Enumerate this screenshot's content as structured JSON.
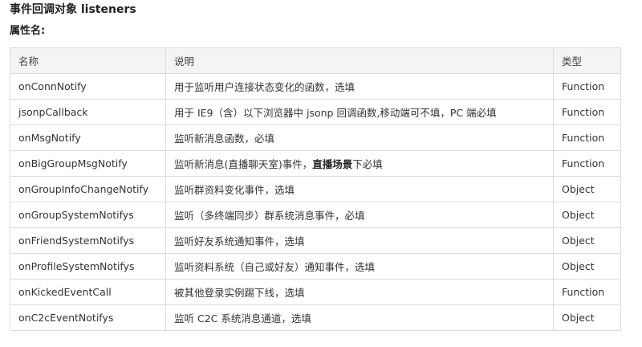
{
  "title": "事件回调对象 listeners",
  "subtitle": "属性名:",
  "table": {
    "headers": [
      "名称",
      "说明",
      "类型"
    ],
    "rows": [
      {
        "name": "onConnNotify",
        "desc": "用于监听用户连接状态变化的函数，选填",
        "type": "Function"
      },
      {
        "name": "jsonpCallback",
        "desc": "用于 IE9（含）以下浏览器中 jsonp 回调函数,移动端可不填，PC 端必填",
        "type": "Function"
      },
      {
        "name": "onMsgNotify",
        "desc": "监听新消息函数，必填",
        "type": "Function"
      },
      {
        "name": "onBigGroupMsgNotify",
        "desc_pre": "监听新消息(直播聊天室)事件，",
        "desc_bold": "直播场景",
        "desc_post": "下必填",
        "type": "Function"
      },
      {
        "name": "onGroupInfoChangeNotify",
        "desc": "监听群资料变化事件，选填",
        "type": "Object"
      },
      {
        "name": "onGroupSystemNotifys",
        "desc": "监听（多终端同步）群系统消息事件，必填",
        "type": "Object"
      },
      {
        "name": "onFriendSystemNotifys",
        "desc": "监听好友系统通知事件，选填",
        "type": "Object"
      },
      {
        "name": "onProfileSystemNotifys",
        "desc": "监听资料系统（自己或好友）通知事件，选填",
        "type": "Object"
      },
      {
        "name": "onKickedEventCall",
        "desc": "被其他登录实例踢下线，选填",
        "type": "Function"
      },
      {
        "name": "onC2cEventNotifys",
        "desc": "监听 C2C 系统消息通道，选填",
        "type": "Object"
      }
    ]
  }
}
